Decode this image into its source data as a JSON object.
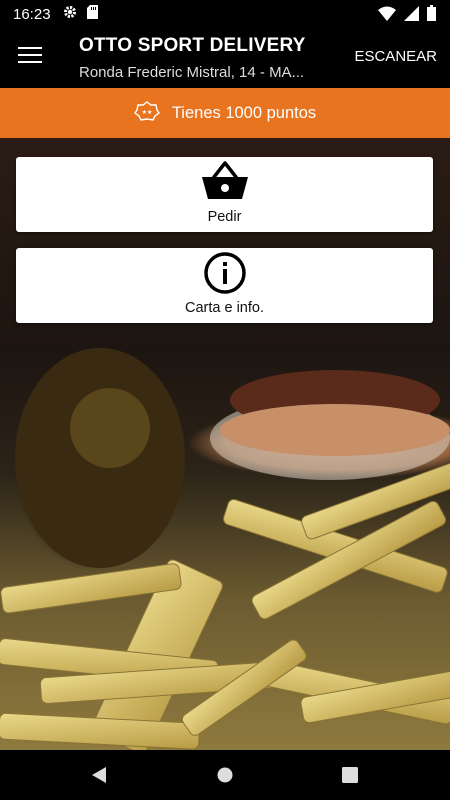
{
  "status_bar": {
    "time": "16:23",
    "icons": [
      "gear-icon",
      "sd-card-icon",
      "wifi-icon",
      "signal-icon",
      "battery-icon"
    ]
  },
  "app_bar": {
    "title": "OTTO SPORT DELIVERY",
    "subtitle": "Ronda Frederic Mistral, 14 - MA...",
    "scan_label": "ESCANEAR",
    "menu_icon": "hamburger-menu-icon"
  },
  "points": {
    "text": "Tienes 1000 puntos",
    "icon": "badge-icon",
    "color": "#e8741f"
  },
  "cards": [
    {
      "label": "Pedir",
      "icon": "basket-icon"
    },
    {
      "label": "Carta e info.",
      "icon": "info-icon"
    }
  ],
  "nav_bar": {
    "icons": [
      "back-icon",
      "home-icon",
      "recents-icon"
    ]
  }
}
